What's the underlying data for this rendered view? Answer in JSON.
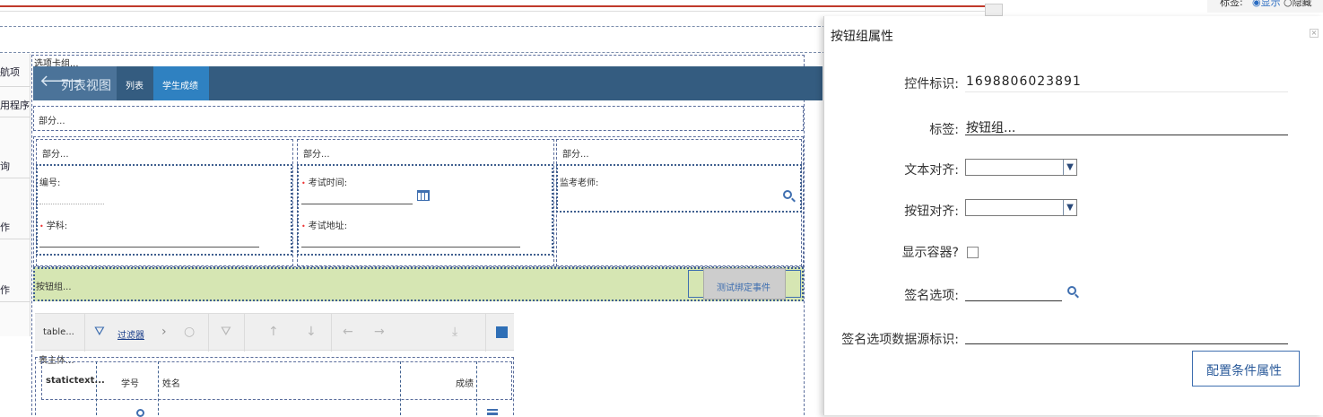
{
  "top_right_strip": {
    "label": "标签:",
    "opt_show": "显示",
    "opt_hide": "隐藏"
  },
  "left_nav": {
    "items": [
      {
        "label": "航项"
      },
      {
        "label": "用程序"
      },
      {
        "label": "询"
      },
      {
        "label": "作"
      },
      {
        "label": "作"
      }
    ]
  },
  "canvas": {
    "tabgroup_label": "选项卡组...",
    "back_label": "列表视图",
    "tabs": [
      {
        "label": "列表"
      },
      {
        "label": "学生成绩"
      }
    ],
    "section_top": "部分...",
    "sections": [
      {
        "header": "部分...",
        "fields": [
          {
            "label": "编号:"
          },
          {
            "label": "学科:"
          }
        ]
      },
      {
        "header": "部分...",
        "fields": [
          {
            "label": "考试时间:"
          },
          {
            "label": "考试地址:"
          }
        ]
      },
      {
        "header": "部分...",
        "fields": [
          {
            "label": "监考老师:"
          }
        ]
      }
    ],
    "button_group_label": "按钮组...",
    "test_button_label": "测试绑定事件",
    "table": {
      "toolbar_label": "table...",
      "filter_label": "过滤器",
      "body_label": "表主体...",
      "columns": [
        "statictext...",
        "学号",
        "姓名",
        "成绩"
      ]
    }
  },
  "dialog": {
    "title": "按钮组属性",
    "fields": {
      "control_id_label": "控件标识:",
      "control_id_value": "1698806023891",
      "tag_label": "标签:",
      "tag_value": "按钮组...",
      "text_align_label": "文本对齐:",
      "button_align_label": "按钮对齐:",
      "show_container_label": "显示容器?",
      "sign_option_label": "签名选项:",
      "sign_ds_label": "签名选项数据源标识:"
    },
    "config_button_label": "配置条件属性"
  },
  "colors": {
    "tab_header": "#345c80",
    "tab_active": "#2f81c1",
    "button_group_bg": "#d6e6b3",
    "accent": "#3f6fb0",
    "top_red_line": "#c0392b"
  }
}
